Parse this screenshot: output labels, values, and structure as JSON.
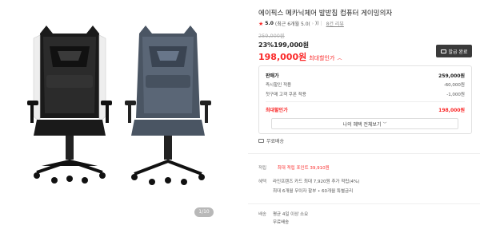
{
  "image": {
    "counter": "1/10"
  },
  "product": {
    "title": "에이픽스 메카닉체어 발받침 컴퓨터 게이밍의자",
    "rating": "5.0",
    "rating_note": "(최근 6개월 5.0(",
    "rating_note_end": "))",
    "reviews": "8건 리뷰",
    "original_price": "259,000원",
    "discount_pct": "23%",
    "discount_price": "199,000원",
    "max_price": "198,000원",
    "max_label": "최대할인가"
  },
  "coupon": {
    "label": "발급 완료"
  },
  "breakdown": {
    "rows": [
      {
        "label": "판매가",
        "value": "259,000원"
      },
      {
        "label": "즉시할인 적용",
        "value": "-60,000원"
      },
      {
        "label": "첫구매 고객 쿠폰 적용",
        "value": "-1,000원"
      }
    ],
    "total_label": "최대할인가",
    "total_value": "198,000원",
    "more": "나의 혜택 전체보기"
  },
  "shipping_free": "무료배송",
  "points": {
    "label": "적립",
    "value": "최대 적립 포인트 39,910원"
  },
  "benefits": {
    "label": "혜택",
    "line1": "라인프렌즈 카드 최대 7,920원 추가 적립(4%)",
    "line2": "최대 6개월 무이자 할부 • 60개월 특별금리"
  },
  "delivery": {
    "label": "배송",
    "line1": "평균 4일 이상 소요",
    "line2": "무료배송"
  }
}
